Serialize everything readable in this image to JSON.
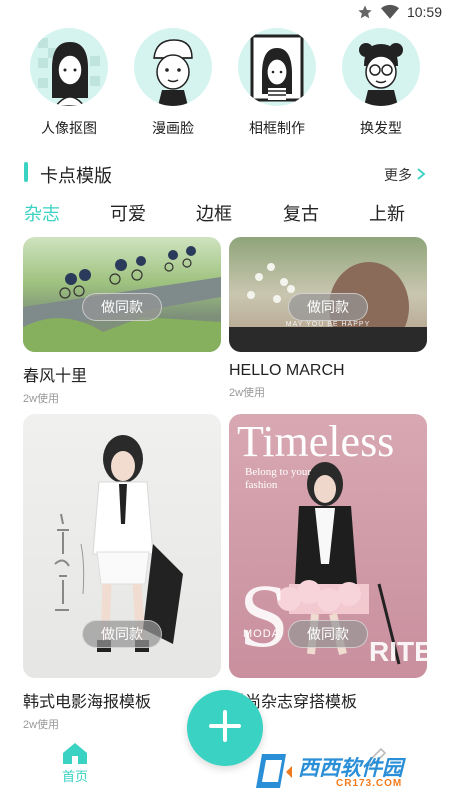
{
  "status_bar": {
    "time": "10:59"
  },
  "tools": [
    {
      "label": "人像抠图",
      "icon": "portrait-cutout-icon"
    },
    {
      "label": "漫画脸",
      "icon": "cartoon-face-icon"
    },
    {
      "label": "相框制作",
      "icon": "photo-frame-icon"
    },
    {
      "label": "换发型",
      "icon": "hairstyle-icon"
    }
  ],
  "section": {
    "title": "卡点模版",
    "more": "更多"
  },
  "tabs": [
    {
      "label": "杂志",
      "active": true
    },
    {
      "label": "可爱",
      "active": false
    },
    {
      "label": "边框",
      "active": false
    },
    {
      "label": "复古",
      "active": false
    },
    {
      "label": "上新",
      "active": false
    }
  ],
  "cards": [
    {
      "title": "春风十里",
      "usage": "2w使用",
      "button": "做同款"
    },
    {
      "title": "HELLO MARCH",
      "usage": "2w使用",
      "button": "做同款",
      "overlay_text": "MAY YOU BE HAPPY"
    },
    {
      "title": "韩式电影海报模板",
      "usage": "2w使用",
      "button": "做同款"
    },
    {
      "title": "时尚杂志穿搭模板",
      "usage": "",
      "button": "做同款",
      "overlay_text": "Timeless",
      "overlay_sub": "Belong to your fashion",
      "overlay_moda": "MODA",
      "overlay_rite": "RITE"
    }
  ],
  "bottom_nav": {
    "home_label": "首页"
  },
  "watermark": {
    "brand": "西西软件园",
    "url": "CR173.COM"
  },
  "colors": {
    "accent": "#3ad2c2"
  }
}
